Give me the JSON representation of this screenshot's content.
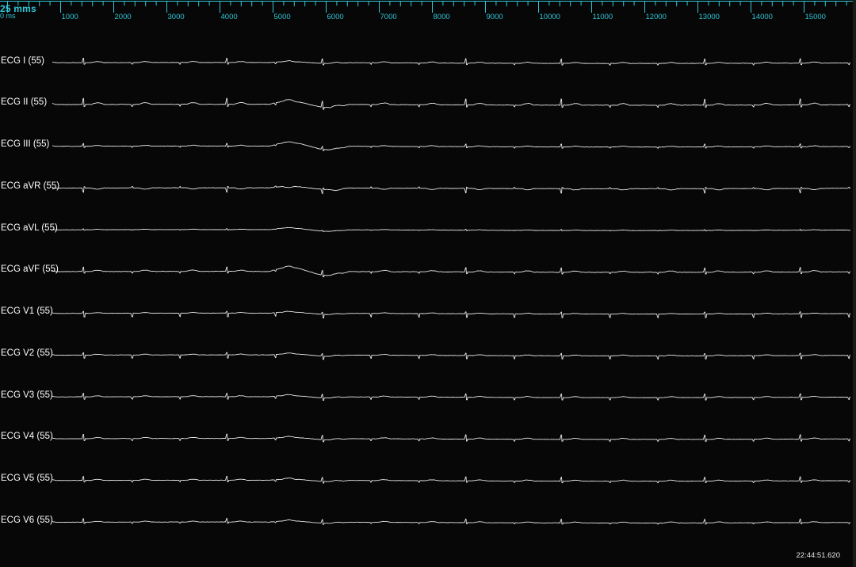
{
  "ruler": {
    "sweep_speed": "25 mms",
    "unit_label": "0 ms",
    "tick_labels": [
      "1000",
      "2000",
      "3000",
      "4000",
      "5000",
      "6000",
      "7000",
      "8000",
      "9000",
      "10000",
      "11000",
      "12000",
      "13000",
      "14000",
      "15000"
    ]
  },
  "leads": [
    {
      "label": "ECG I (55)",
      "id": "i"
    },
    {
      "label": "ECG II (55)",
      "id": "ii"
    },
    {
      "label": "ECG III (55)",
      "id": "iii"
    },
    {
      "label": "ECG aVR (55)",
      "id": "avr"
    },
    {
      "label": "ECG aVL (55)",
      "id": "avl"
    },
    {
      "label": "ECG aVF (55)",
      "id": "avf"
    },
    {
      "label": "ECG V1 (55)",
      "id": "v1"
    },
    {
      "label": "ECG V2 (55)",
      "id": "v2"
    },
    {
      "label": "ECG V3 (55)",
      "id": "v3"
    },
    {
      "label": "ECG V4 (55)",
      "id": "v4"
    },
    {
      "label": "ECG V5 (55)",
      "id": "v5"
    },
    {
      "label": "ECG V6 (55)",
      "id": "v6"
    }
  ],
  "timestamp": "22:44:51.620",
  "colors": {
    "background": "#070707",
    "ruler": "#30c6d6",
    "trace": "#e6e6e6",
    "label": "#ffffff"
  }
}
